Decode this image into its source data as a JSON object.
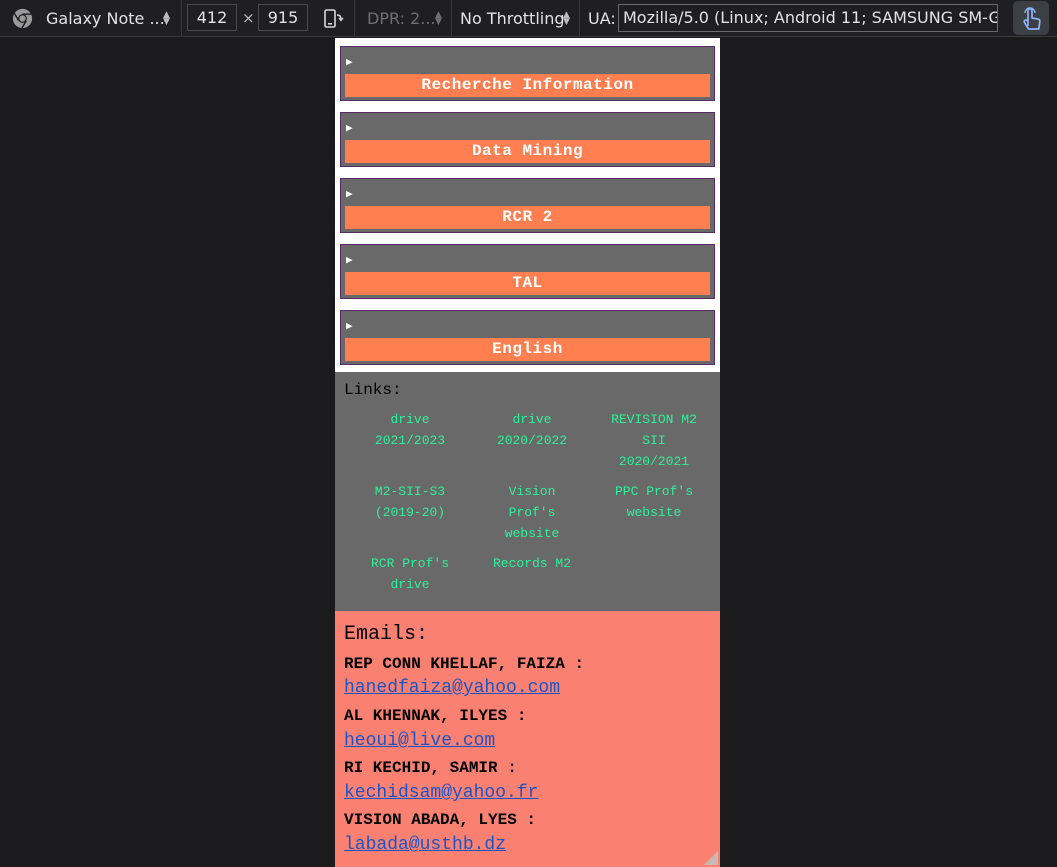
{
  "toolbar": {
    "device": "Galaxy Note ...",
    "width": "412",
    "height": "915",
    "times": "×",
    "dpr": "DPR: 2...",
    "throttling": "No Throttling",
    "ua_label": "UA:",
    "ua_value": "Mozilla/5.0 (Linux; Android 11; SAMSUNG SM-G97",
    "icons": [
      "chrome-icon",
      "rotate-icon",
      "touch-icon"
    ]
  },
  "modules": [
    {
      "label": "Recherche Information"
    },
    {
      "label": "Data Mining"
    },
    {
      "label": "RCR 2"
    },
    {
      "label": "TAL"
    },
    {
      "label": "English"
    }
  ],
  "disclosure_glyph": "▶",
  "links": {
    "title": "Links:",
    "items": [
      {
        "lines": [
          "drive",
          "2021/2023"
        ]
      },
      {
        "lines": [
          "drive",
          "2020/2022"
        ]
      },
      {
        "lines": [
          "REVISION M2",
          "SII",
          "2020/2021"
        ]
      },
      {
        "lines": [
          "M2-SII-S3",
          "(2019-20)"
        ]
      },
      {
        "lines": [
          "Vision",
          "Prof's",
          "website"
        ]
      },
      {
        "lines": [
          "PPC Prof's",
          "website"
        ]
      },
      {
        "lines": [
          "RCR Prof's",
          "drive"
        ]
      },
      {
        "lines": [
          "Records M2"
        ]
      }
    ]
  },
  "emails": {
    "title": "Emails:",
    "entries": [
      {
        "name": "REP CONN KHELLAF, FAIZA :",
        "email": "hanedfaiza@yahoo.com"
      },
      {
        "name": "AL KHENNAK, ILYES :",
        "email": "heoui@live.com"
      },
      {
        "name": "RI KECHID, SAMIR :",
        "email": "kechidsam@yahoo.fr"
      },
      {
        "name": "VISION ABADA, LYES :",
        "email": "labada@usthb.dz"
      }
    ]
  },
  "colors": {
    "module_bg": "#696969",
    "module_bar": "#ff7f50",
    "link": "#2cf29b",
    "emails_bg": "#fa8072",
    "email_link": "#1a55c7"
  }
}
